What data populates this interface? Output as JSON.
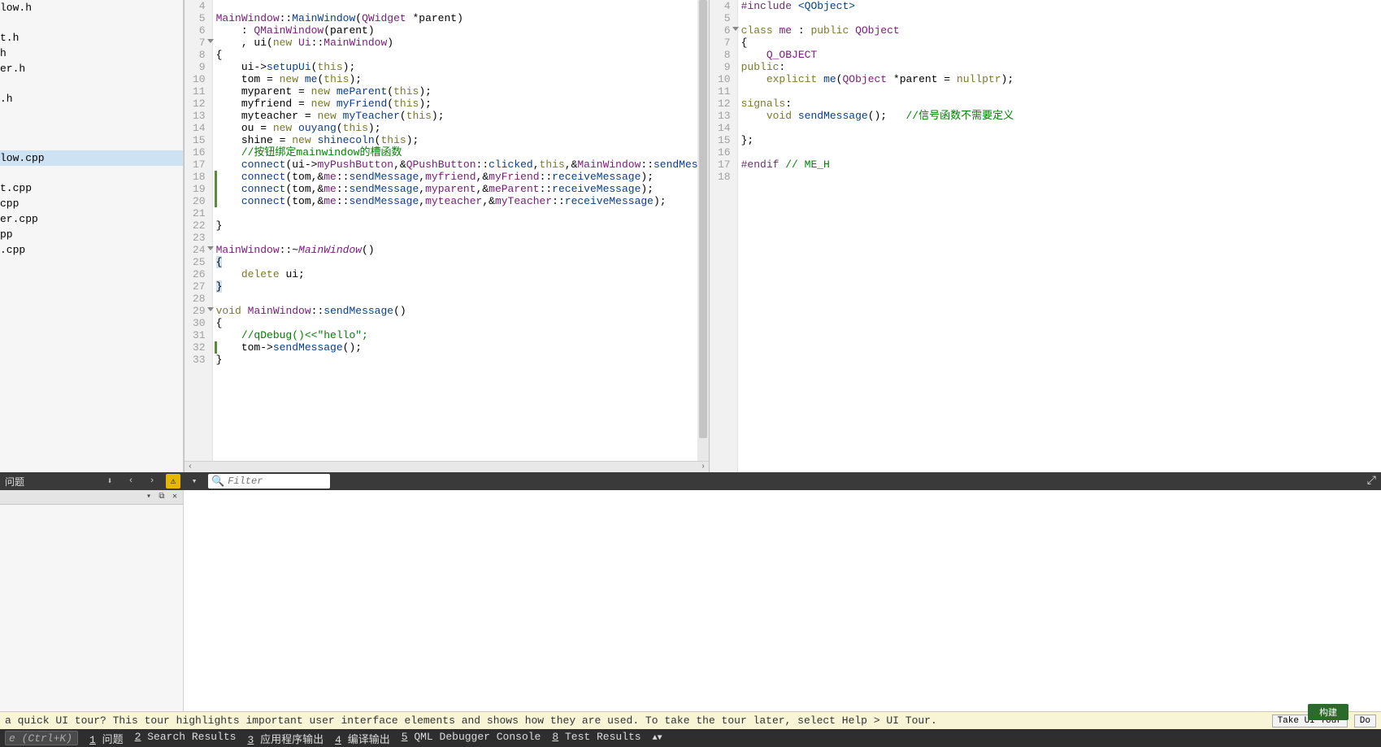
{
  "sidebar": {
    "files": [
      {
        "name": "low.h"
      },
      {
        "name": ""
      },
      {
        "name": "t.h"
      },
      {
        "name": "h"
      },
      {
        "name": "er.h"
      },
      {
        "name": ""
      },
      {
        "name": ".h"
      },
      {
        "name": ""
      },
      {
        "name": ""
      },
      {
        "name": ""
      },
      {
        "name": "low.cpp",
        "selected": true
      },
      {
        "name": ""
      },
      {
        "name": "t.cpp"
      },
      {
        "name": "cpp"
      },
      {
        "name": "er.cpp"
      },
      {
        "name": "pp"
      },
      {
        "name": ".cpp"
      }
    ]
  },
  "editor1": {
    "startLine": 4,
    "folds": [
      7,
      24,
      29
    ],
    "diffMarks": [
      18,
      19,
      20,
      32
    ],
    "rows": [
      "",
      "<span class='cls'>MainWindow</span>::<span class='fn'>MainWindow</span>(<span class='cls'>QWidget</span> *parent)",
      "    : <span class='cls'>QMainWindow</span>(parent)",
      "    , ui(<span class='kw'>new</span> <span class='cls'>Ui</span>::<span class='cls'>MainWindow</span>)",
      "{",
      "    ui-&gt;<span class='fn'>setupUi</span>(<span class='kw'>this</span>);",
      "    tom = <span class='kw'>new</span> <span class='fn'>me</span>(<span class='kw'>this</span>);",
      "    myparent = <span class='kw'>new</span> <span class='fn'>meParent</span>(<span class='kw'>this</span>);",
      "    myfriend = <span class='kw'>new</span> <span class='fn'>myFriend</span>(<span class='kw'>this</span>);",
      "    myteacher = <span class='kw'>new</span> <span class='fn'>myTeacher</span>(<span class='kw'>this</span>);",
      "    ou = <span class='kw'>new</span> <span class='fn'>ouyang</span>(<span class='kw'>this</span>);",
      "    shine = <span class='kw'>new</span> <span class='fn'>shinecoln</span>(<span class='kw'>this</span>);",
      "    <span class='cmt'>//按钮绑定mainwindow的槽函数</span>",
      "    <span class='fn'>connect</span>(ui-&gt;<span class='cls'>myPushButton</span>,&amp;<span class='cls'>QPushButton</span>::<span class='fn'>clicked</span>,<span class='kw'>this</span>,&amp;<span class='cls'>MainWindow</span>::<span class='fn'>sendMessage</span>);",
      "    <span class='fn'>connect</span>(tom,&amp;<span class='cls'>me</span>::<span class='fn'>sendMessage</span>,<span class='cls'>myfriend</span>,&amp;<span class='cls'>myFriend</span>::<span class='fn'>receiveMessage</span>);",
      "    <span class='fn'>connect</span>(tom,&amp;<span class='cls'>me</span>::<span class='fn'>sendMessage</span>,<span class='cls'>myparent</span>,&amp;<span class='cls'>meParent</span>::<span class='fn'>receiveMessage</span>);",
      "    <span class='fn'>connect</span>(tom,&amp;<span class='cls'>me</span>::<span class='fn'>sendMessage</span>,<span class='cls'>myteacher</span>,&amp;<span class='cls'>myTeacher</span>::<span class='fn'>receiveMessage</span>);",
      "",
      "}",
      "",
      "<span class='cls'>MainWindow</span>::~<span class='cls ital'>MainWindow</span>()",
      "<span style='background:#cde2f3;'>{</span>",
      "    <span class='kw'>delete</span> ui;",
      "<span style='background:#cde2f3;'>}</span>",
      "",
      "<span class='kw'>void</span> <span class='cls'>MainWindow</span>::<span class='fn'>sendMessage</span>()",
      "{",
      "    <span class='cmt'>//qDebug()&lt;&lt;\"hello\";</span>",
      "    tom-&gt;<span class='fn'>sendMessage</span>();",
      "}"
    ]
  },
  "editor2": {
    "startLine": 4,
    "folds": [
      6
    ],
    "rows": [
      "<span class='pp'>#include</span> <span class='pp2'>&lt;QObject&gt;</span>",
      "",
      "<span class='kw'>class</span> <span class='cls'>me</span> : <span class='kw'>public</span> <span class='cls'>QObject</span>",
      "{",
      "    <span class='cls'>Q_OBJECT</span>",
      "<span class='kw'>public</span>:",
      "    <span class='kw'>explicit</span> <span class='fn'>me</span>(<span class='cls'>QObject</span> *parent = <span class='kw'>nullptr</span>);",
      "",
      "<span class='kw'>signals</span>:",
      "    <span class='kw'>void</span> <span class='fn'>sendMessage</span>();   <span class='cmt'>//信号函数不需要定义</span>",
      "",
      "};",
      "",
      "<span class='pp'>#endif</span> <span class='cmt'>// ME_H</span>",
      ""
    ]
  },
  "issues": {
    "title": "问题",
    "filterPlaceholder": "Filter"
  },
  "tour": {
    "msg": " a quick UI tour? This tour highlights important user interface elements and shows how they are used. To take the tour later, select Help > UI Tour.",
    "take": "Take UI Tour",
    "dont": "Do",
    "buildBadge": "构建"
  },
  "status": {
    "searchPlaceholder": "e (Ctrl+K)",
    "tabs": [
      {
        "n": "1",
        "t": "问题"
      },
      {
        "n": "2",
        "t": "Search Results"
      },
      {
        "n": "3",
        "t": "应用程序输出"
      },
      {
        "n": "4",
        "t": "编译输出"
      },
      {
        "n": "5",
        "t": "QML Debugger Console"
      },
      {
        "n": "8",
        "t": "Test Results"
      }
    ]
  }
}
